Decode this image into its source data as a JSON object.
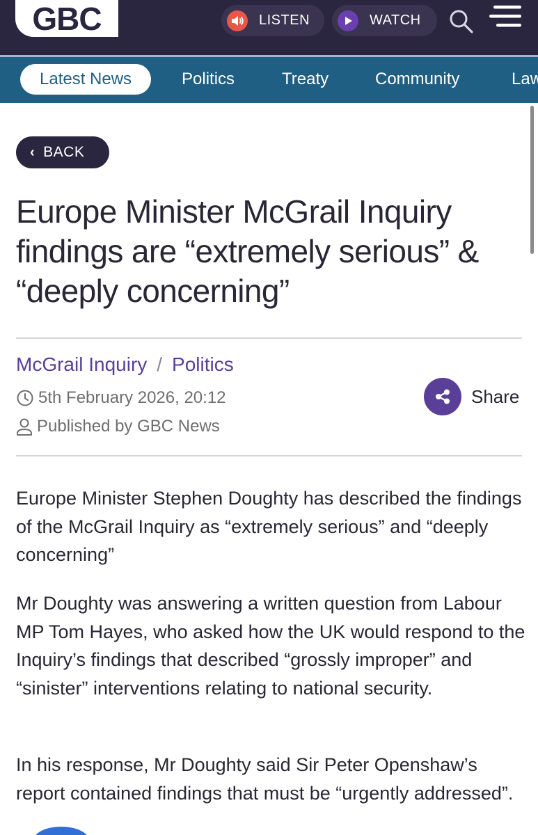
{
  "header": {
    "logo_text": "GBC",
    "listen_label": "LISTEN",
    "watch_label": "WATCH",
    "colors": {
      "background": "#2b2640",
      "listen_accent": "#e8574a",
      "watch_accent": "#6a3fb0"
    }
  },
  "nav": {
    "items": [
      {
        "label": "Latest News",
        "active": true
      },
      {
        "label": "Politics"
      },
      {
        "label": "Treaty"
      },
      {
        "label": "Community"
      },
      {
        "label": "Law"
      }
    ],
    "color": "#1f5f84"
  },
  "back_label": "BACK",
  "article": {
    "title": "Europe Minister McGrail Inquiry findings are “extremely serious” & “deeply concerning”",
    "categories": [
      "McGrail Inquiry",
      "Politics"
    ],
    "category_separator": "/",
    "date": "5th February 2026, 20:12",
    "author": "Published by GBC News",
    "share_label": "Share",
    "paragraphs": [
      "Europe Minister Stephen Doughty has described the findings of the McGrail Inquiry as “extremely serious” and “deeply concerning”",
      "Mr Doughty was answering a written question from Labour MP Tom Hayes, who asked how the UK would respond to the Inquiry’s findings that described “grossly improper” and “sinister” interventions relating to national security.",
      "In his response, Mr Doughty said Sir Peter Openshaw’s report contained findings that must be “urgently addressed”."
    ],
    "accent": "#5a3f99"
  }
}
